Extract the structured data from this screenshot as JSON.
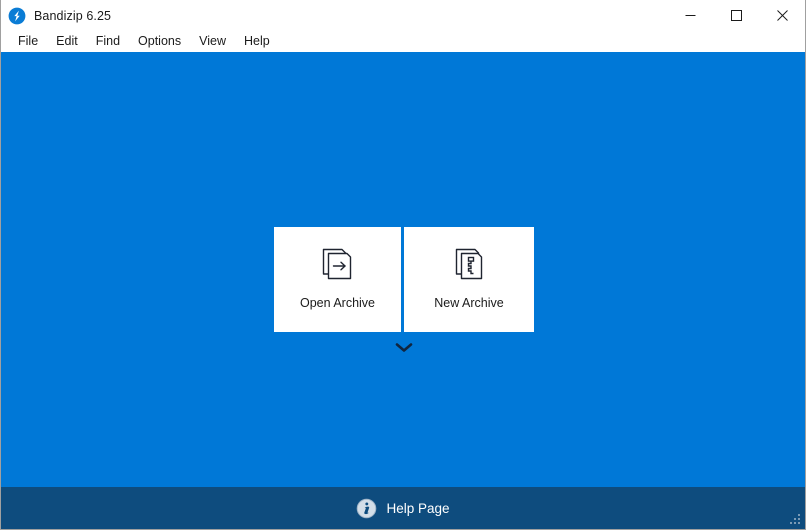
{
  "window": {
    "title": "Bandizip 6.25",
    "app_icon": "bandizip-logo-icon",
    "controls": {
      "minimize": "minimize-icon",
      "maximize": "maximize-icon",
      "close": "close-icon"
    }
  },
  "menu": {
    "items": [
      {
        "label": "File"
      },
      {
        "label": "Edit"
      },
      {
        "label": "Find"
      },
      {
        "label": "Options"
      },
      {
        "label": "View"
      },
      {
        "label": "Help"
      }
    ]
  },
  "main": {
    "actions": [
      {
        "label": "Open Archive",
        "icon": "open-archive-icon"
      },
      {
        "label": "New Archive",
        "icon": "new-archive-icon"
      }
    ],
    "expand": {
      "icon": "chevron-down-icon"
    }
  },
  "help_bar": {
    "label": "Help Page",
    "icon": "info-icon"
  },
  "colors": {
    "canvas_blue": "#0078d7",
    "help_bar_blue": "#0e4c7e",
    "panel_white": "#ffffff",
    "text_dark": "#1b1b1b",
    "icon_stroke": "#1f2430"
  }
}
